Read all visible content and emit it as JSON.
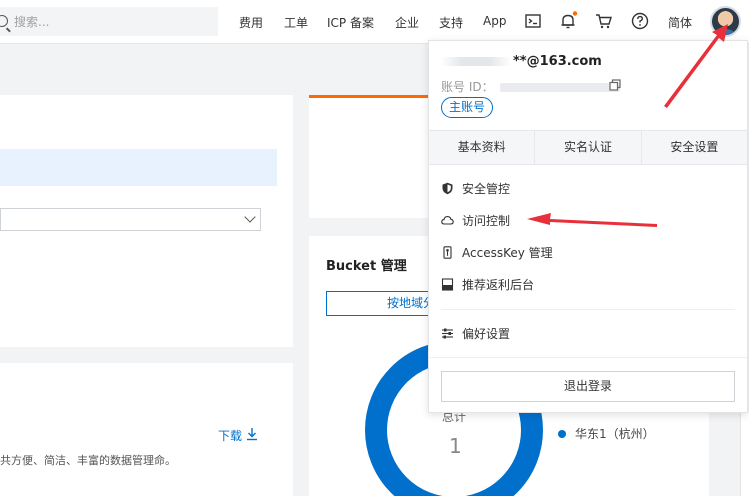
{
  "search": {
    "placeholder": "搜索..."
  },
  "nav": {
    "items": [
      "费用",
      "工单",
      "ICP 备案",
      "企业",
      "支持",
      "App"
    ],
    "language": "简体",
    "icons": [
      "terminal-icon",
      "bell-icon",
      "cart-icon",
      "help-icon"
    ]
  },
  "account": {
    "email_suffix": "**@163.com",
    "account_id_label": "账号 ID：",
    "badge": "主账号"
  },
  "tabs": [
    "基本资料",
    "实名认证",
    "安全设置"
  ],
  "menu": {
    "security_control": "安全管控",
    "access_control": "访问控制",
    "accesskey": "AccessKey 管理",
    "rebate": "推荐返利后台",
    "preferences": "偏好设置",
    "logout": "退出登录"
  },
  "background": {
    "download": "下载",
    "description": "共方便、简洁、丰富的数据管理命。",
    "bucket_title": "Bucket 管理",
    "region_button": "按地域分",
    "total_label": "总计",
    "total_value": "1",
    "legend_region": "华东1（杭州）"
  },
  "colors": {
    "brand_blue": "#0070cc",
    "accent_orange": "#ff6a00",
    "annotation_red": "#e8303a"
  }
}
